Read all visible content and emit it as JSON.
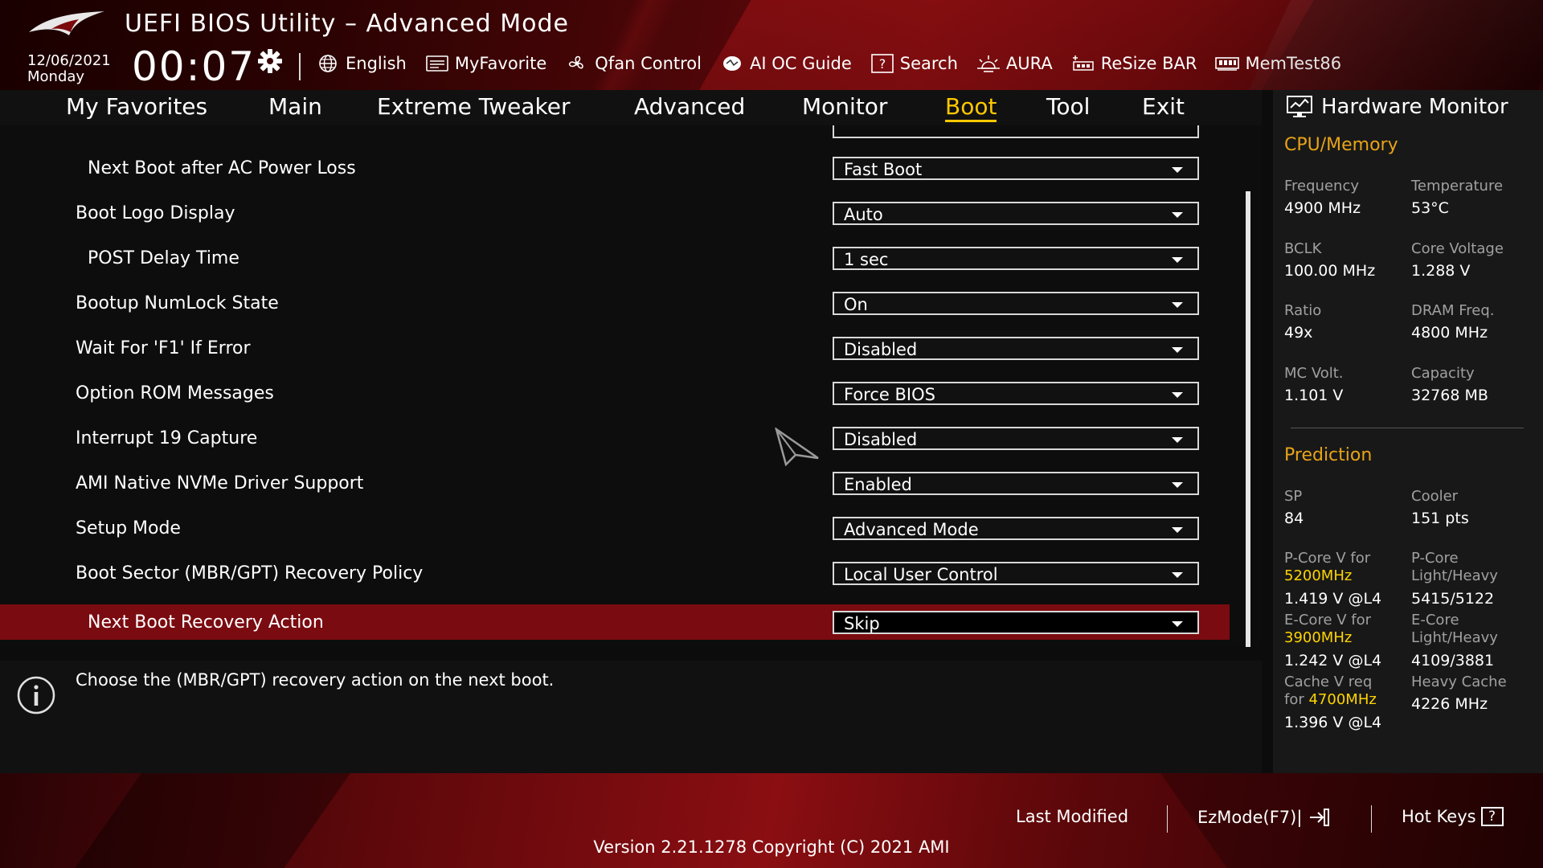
{
  "header": {
    "title": "UEFI BIOS Utility – Advanced Mode",
    "date": "12/06/2021",
    "day": "Monday",
    "time": "00:07"
  },
  "toolbar": [
    {
      "label": "English",
      "icon": "globe-icon"
    },
    {
      "label": "MyFavorite",
      "icon": "favorite-icon"
    },
    {
      "label": "Qfan Control",
      "icon": "fan-icon"
    },
    {
      "label": "AI OC Guide",
      "icon": "chip-icon"
    },
    {
      "label": "Search",
      "icon": "question-icon"
    },
    {
      "label": "AURA",
      "icon": "aura-icon"
    },
    {
      "label": "ReSize BAR",
      "icon": "resize-bar-icon"
    },
    {
      "label": "MemTest86",
      "icon": "memory-icon"
    }
  ],
  "tabs": [
    "My Favorites",
    "Main",
    "Extreme Tweaker",
    "Advanced",
    "Monitor",
    "Boot",
    "Tool",
    "Exit"
  ],
  "active_tab": "Boot",
  "settings": [
    {
      "label": "Next Boot after AC Power Loss",
      "value": "Fast Boot"
    },
    {
      "label": "Boot Logo Display",
      "value": "Auto"
    },
    {
      "label": "POST Delay Time",
      "value": "1 sec"
    },
    {
      "label": "Bootup NumLock State",
      "value": "On"
    },
    {
      "label": "Wait For 'F1' If Error",
      "value": "Disabled"
    },
    {
      "label": "Option ROM Messages",
      "value": "Force BIOS"
    },
    {
      "label": "Interrupt 19 Capture",
      "value": "Disabled"
    },
    {
      "label": "AMI Native NVMe Driver Support",
      "value": "Enabled"
    },
    {
      "label": "Setup Mode",
      "value": "Advanced Mode"
    },
    {
      "label": "Boot Sector (MBR/GPT) Recovery Policy",
      "value": "Local User Control"
    },
    {
      "label": "Next Boot Recovery Action",
      "value": "Skip",
      "selected": true
    }
  ],
  "help_text": "Choose the (MBR/GPT) recovery action on the next boot.",
  "hardware_monitor": {
    "title": "Hardware Monitor",
    "cpu_memory": {
      "heading": "CPU/Memory",
      "frequency_label": "Frequency",
      "frequency": "4900 MHz",
      "temperature_label": "Temperature",
      "temperature": "53°C",
      "bclk_label": "BCLK",
      "bclk": "100.00 MHz",
      "core_voltage_label": "Core Voltage",
      "core_voltage": "1.288 V",
      "ratio_label": "Ratio",
      "ratio": "49x",
      "dram_label": "DRAM Freq.",
      "dram": "4800 MHz",
      "mc_volt_label": "MC Volt.",
      "mc_volt": "1.101 V",
      "capacity_label": "Capacity",
      "capacity": "32768 MB"
    },
    "prediction": {
      "heading": "Prediction",
      "sp_label": "SP",
      "sp": "84",
      "cooler_label": "Cooler",
      "cooler": "151 pts",
      "pcore_v_label": "P-Core V for",
      "pcore_v_freq": "5200MHz",
      "pcore_v": "1.419 V @L4",
      "pcore_lh_label1": "P-Core",
      "pcore_lh_label2": "Light/Heavy",
      "pcore_lh": "5415/5122",
      "ecore_v_label": "E-Core V for",
      "ecore_v_freq": "3900MHz",
      "ecore_v": "1.242 V @L4",
      "ecore_lh_label1": "E-Core",
      "ecore_lh_label2": "Light/Heavy",
      "ecore_lh": "4109/3881",
      "cache_v_label1": "Cache V req",
      "cache_v_label2": "for",
      "cache_v_freq": "4700MHz",
      "cache_v": "1.396 V @L4",
      "heavy_cache_label": "Heavy Cache",
      "heavy_cache": "4226 MHz"
    }
  },
  "footer": {
    "last_modified": "Last Modified",
    "ezmode": "EzMode(F7)|",
    "hot_keys": "Hot Keys",
    "hot_keys_glyph": "?",
    "version": "Version 2.21.1278 Copyright (C) 2021 AMI"
  },
  "colors": {
    "accent": "#ffc800",
    "section": "#e8a318",
    "highlight": "#ffd400",
    "selected_row": "#7a0b10"
  }
}
